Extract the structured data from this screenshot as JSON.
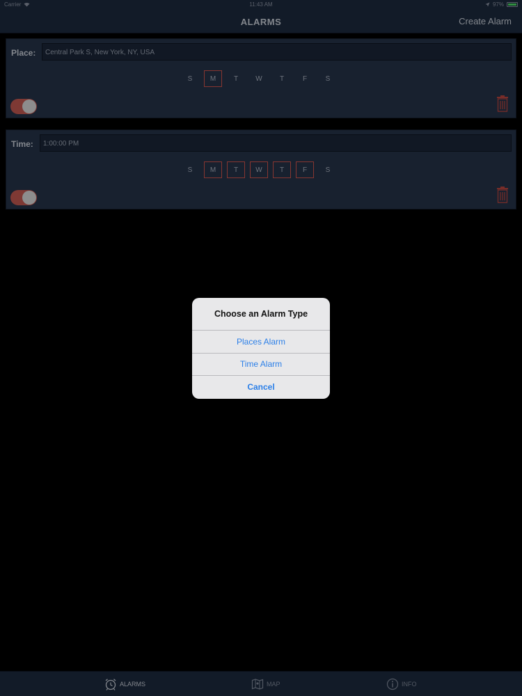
{
  "status_bar": {
    "carrier": "Carrier",
    "time": "11:43 AM",
    "battery": "97%"
  },
  "nav": {
    "title": "ALARMS",
    "action": "Create Alarm"
  },
  "alarms": [
    {
      "label": "Place:",
      "value": "Central Park S, New York, NY, USA",
      "days": [
        {
          "letter": "S",
          "on": false
        },
        {
          "letter": "M",
          "on": true
        },
        {
          "letter": "T",
          "on": false
        },
        {
          "letter": "W",
          "on": false
        },
        {
          "letter": "T",
          "on": false
        },
        {
          "letter": "F",
          "on": false
        },
        {
          "letter": "S",
          "on": false
        }
      ],
      "enabled": true
    },
    {
      "label": "Time:",
      "value": "1:00:00 PM",
      "days": [
        {
          "letter": "S",
          "on": false
        },
        {
          "letter": "M",
          "on": true
        },
        {
          "letter": "T",
          "on": true
        },
        {
          "letter": "W",
          "on": true
        },
        {
          "letter": "T",
          "on": true
        },
        {
          "letter": "F",
          "on": true
        },
        {
          "letter": "S",
          "on": false
        }
      ],
      "enabled": true
    }
  ],
  "alert": {
    "title": "Choose an Alarm Type",
    "options": [
      "Places Alarm",
      "Time Alarm"
    ],
    "cancel": "Cancel"
  },
  "tabs": [
    {
      "label": "ALARMS",
      "icon": "alarm-clock-icon",
      "selected": true
    },
    {
      "label": "MAP",
      "icon": "map-icon",
      "selected": false
    },
    {
      "label": "INFO",
      "icon": "info-icon",
      "selected": false
    }
  ],
  "colors": {
    "bar_bg": "#1d2a3e",
    "card_bg": "#253349",
    "accent_red": "#d0534c",
    "alert_link": "#2b7fe8",
    "battery_green": "#4cd964"
  }
}
